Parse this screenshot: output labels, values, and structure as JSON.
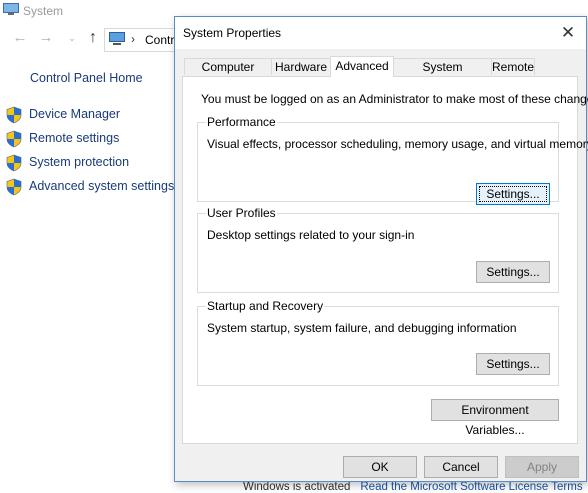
{
  "background_window": {
    "title": "System",
    "address_crumb": "Contr",
    "address_separator": "›",
    "control_panel_home": "Control Panel Home",
    "links": [
      {
        "label": "Device Manager"
      },
      {
        "label": "Remote settings"
      },
      {
        "label": "System protection"
      },
      {
        "label": "Advanced system settings"
      }
    ],
    "bottom_text": "Windows is activated",
    "bottom_link": "Read the Microsoft Software License Terms"
  },
  "dialog": {
    "title": "System Properties",
    "close_glyph": "✕",
    "tabs": [
      {
        "label": "Computer Name",
        "active": false
      },
      {
        "label": "Hardware",
        "active": false
      },
      {
        "label": "Advanced",
        "active": true
      },
      {
        "label": "System Protection",
        "active": false
      },
      {
        "label": "Remote",
        "active": false
      }
    ],
    "admin_note": "You must be logged on as an Administrator to make most of these changes.",
    "groups": {
      "performance": {
        "legend": "Performance",
        "description": "Visual effects, processor scheduling, memory usage, and virtual memory",
        "button": "Settings..."
      },
      "user_profiles": {
        "legend": "User Profiles",
        "description": "Desktop settings related to your sign-in",
        "button": "Settings..."
      },
      "startup_recovery": {
        "legend": "Startup and Recovery",
        "description": "System startup, system failure, and debugging information",
        "button": "Settings..."
      }
    },
    "environment_variables_button": "Environment Variables...",
    "footer": {
      "ok": "OK",
      "cancel": "Cancel",
      "apply": "Apply"
    }
  },
  "colors": {
    "link": "#1a3a78",
    "dialog_border": "#5b8bc5",
    "focus_border": "#0078d7",
    "shield_blue": "#2a6fc9",
    "shield_yellow": "#f2c41c"
  }
}
